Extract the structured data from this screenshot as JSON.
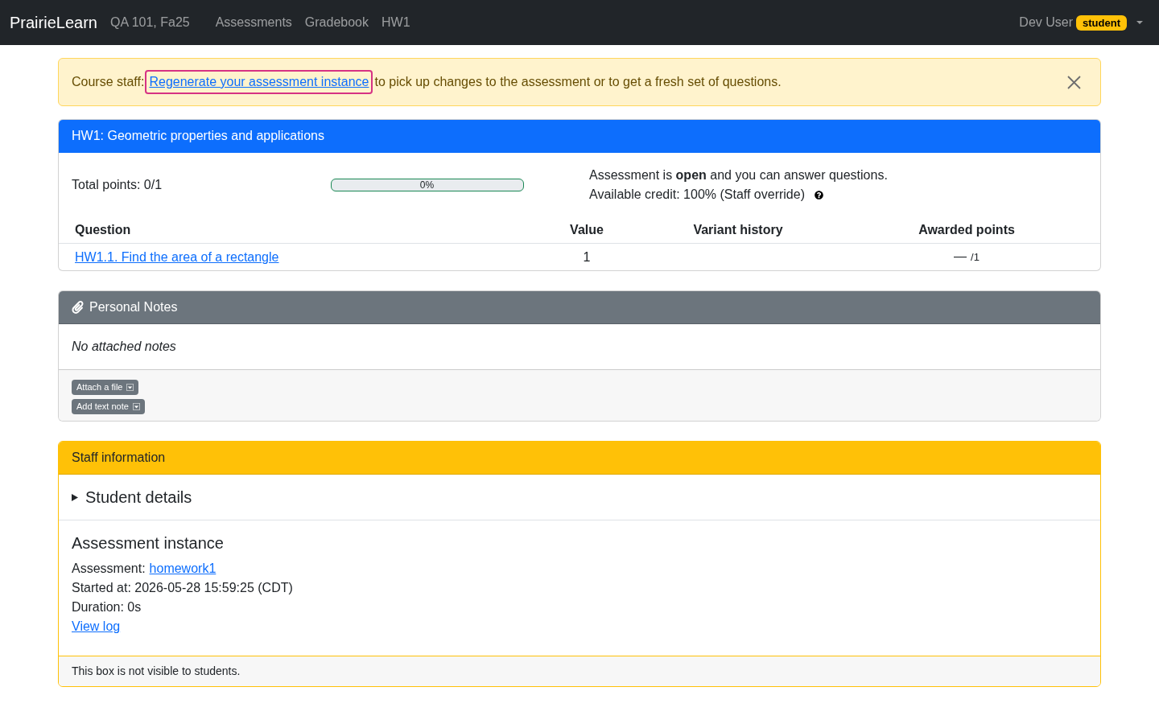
{
  "navbar": {
    "brand": "PrairieLearn",
    "course": "QA 101, Fa25",
    "links": [
      "Assessments",
      "Gradebook",
      "HW1"
    ],
    "user": "Dev User",
    "role_badge": "student"
  },
  "alert": {
    "prefix": "Course staff:",
    "link": {
      "label": "Regenerate your assessment instance",
      "focused": true
    },
    "suffix": "to pick up changes to the assessment or to get a fresh set of questions."
  },
  "assessment_card": {
    "title": "HW1: Geometric properties and applications",
    "total_points": "Total points: 0/1",
    "progress": {
      "label": "0%",
      "level": 0
    },
    "status": "Assessment is **open** and you can answer questions.",
    "credit": "Available credit: 100% (Staff override)",
    "table": {
      "columns": [
        "Question",
        "Value",
        "Variant history",
        "Awarded points"
      ],
      "rows": [
        {
          "question": "HW1.1. Find the area of a rectangle",
          "value": "1",
          "awarded": "—",
          "max_points": "/1"
        }
      ]
    }
  },
  "notes_card": {
    "title": "Personal Notes",
    "empty_text": "No attached notes",
    "buttons": [
      "Attach a file",
      "Add text note"
    ]
  },
  "staff_card": {
    "title": "Staff information",
    "details": {
      "summary": "Student details",
      "expanded": false
    },
    "section_title": "Assessment instance",
    "assessment_label": "Assessment:",
    "assessment_link": "homework1",
    "lines": [
      "Started at: 2026-05-28 15:59:25 (CDT)",
      "Duration: 0s"
    ],
    "log_link": "View log",
    "footer": "This box is not visible to students."
  }
}
